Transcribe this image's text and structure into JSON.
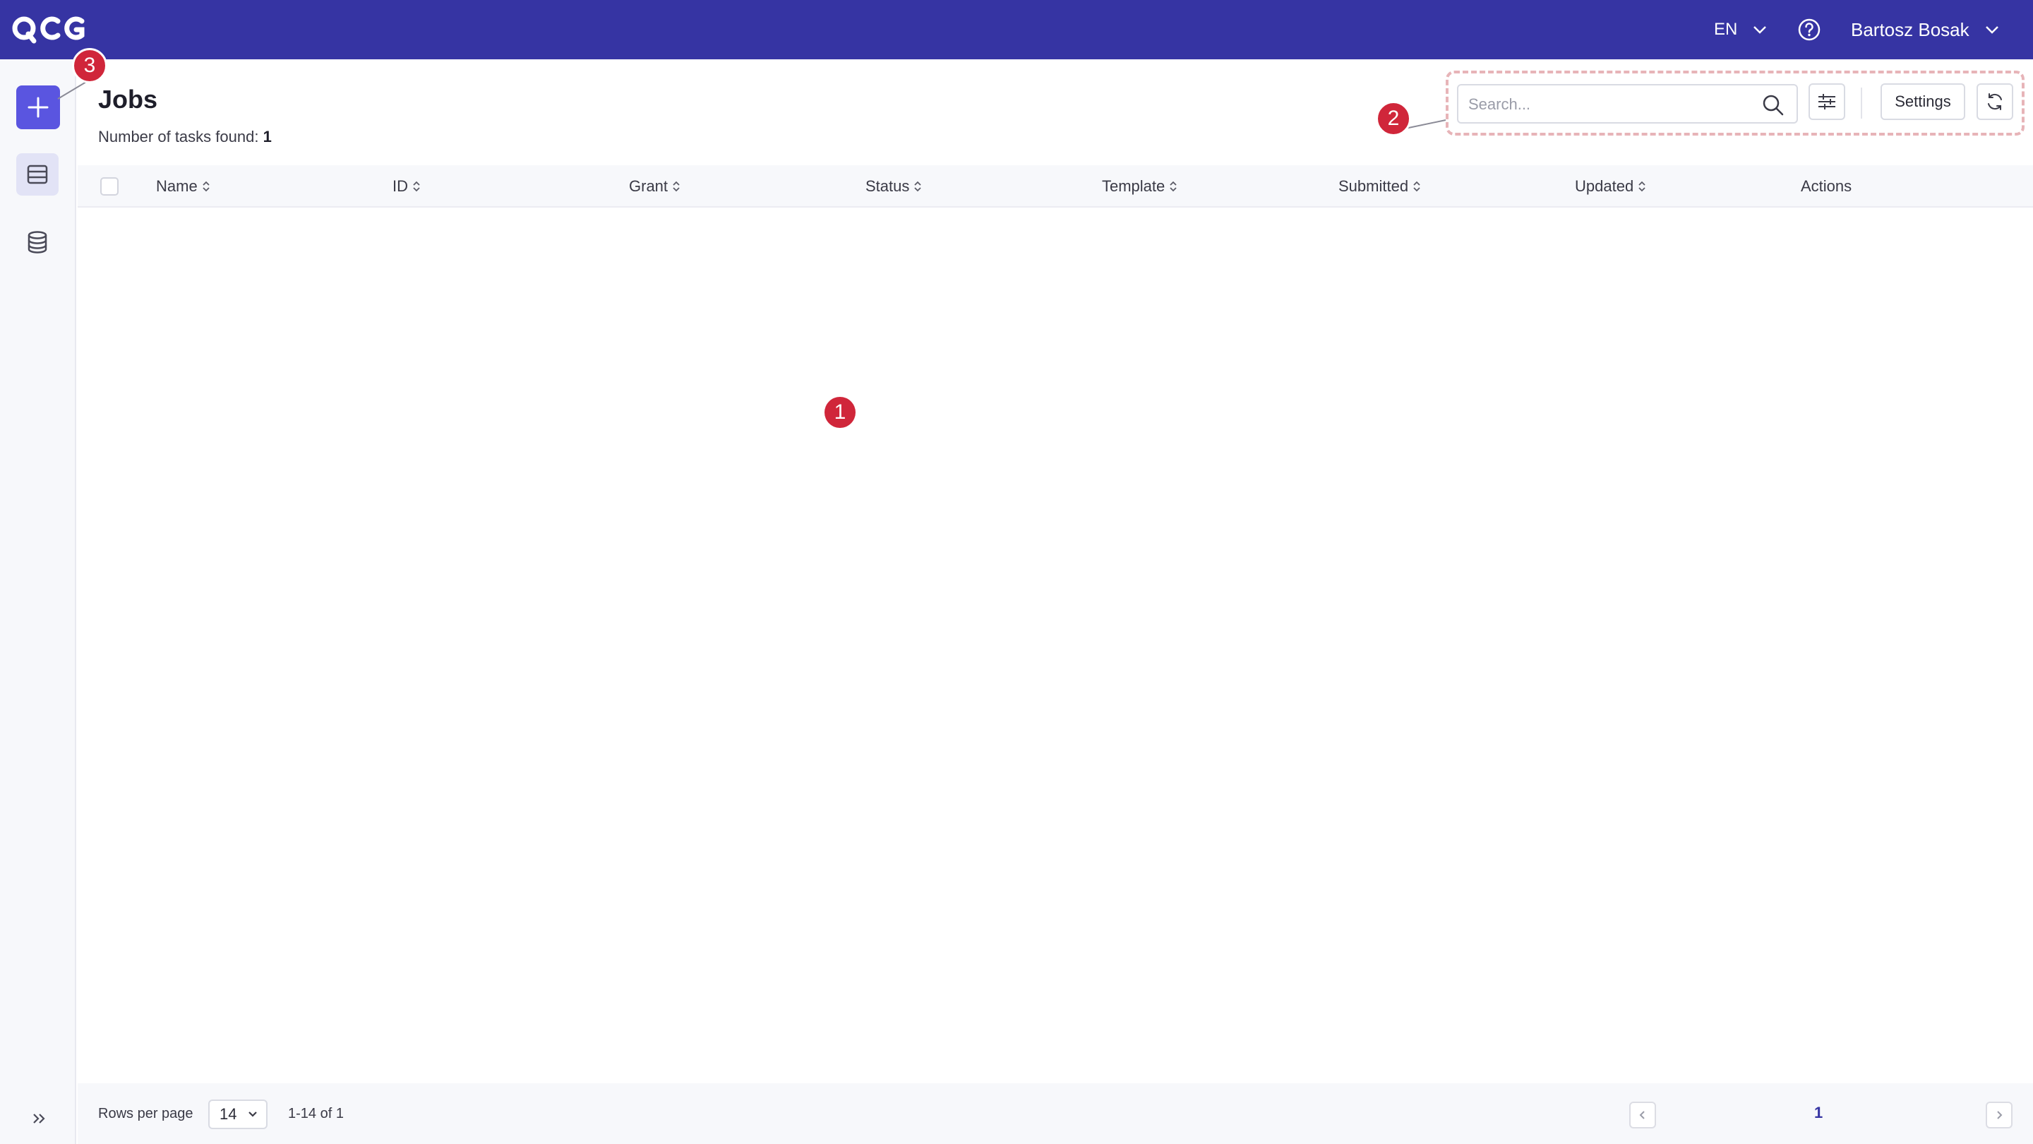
{
  "app": {
    "logo_text": "QCG",
    "language": "EN",
    "user_name": "Bartosz Bosak"
  },
  "page": {
    "title": "Jobs",
    "count_label": "Number of tasks found:",
    "count_value": "1"
  },
  "toolbar": {
    "search_placeholder": "Search...",
    "settings_label": "Settings"
  },
  "table": {
    "columns": [
      "Name",
      "ID",
      "Grant",
      "Status",
      "Template",
      "Submitted",
      "Updated",
      "Actions"
    ],
    "rows": []
  },
  "footer": {
    "rows_per_page_label": "Rows per page",
    "rows_per_page_value": "14",
    "range_text": "1-14 of 1",
    "current_page": "1"
  },
  "annotations": {
    "badge_1": "1",
    "badge_2": "2",
    "badge_3": "3"
  },
  "colors": {
    "topbar": "#3634a3",
    "primary_button": "#5a55e0",
    "badge": "#d0263a"
  }
}
